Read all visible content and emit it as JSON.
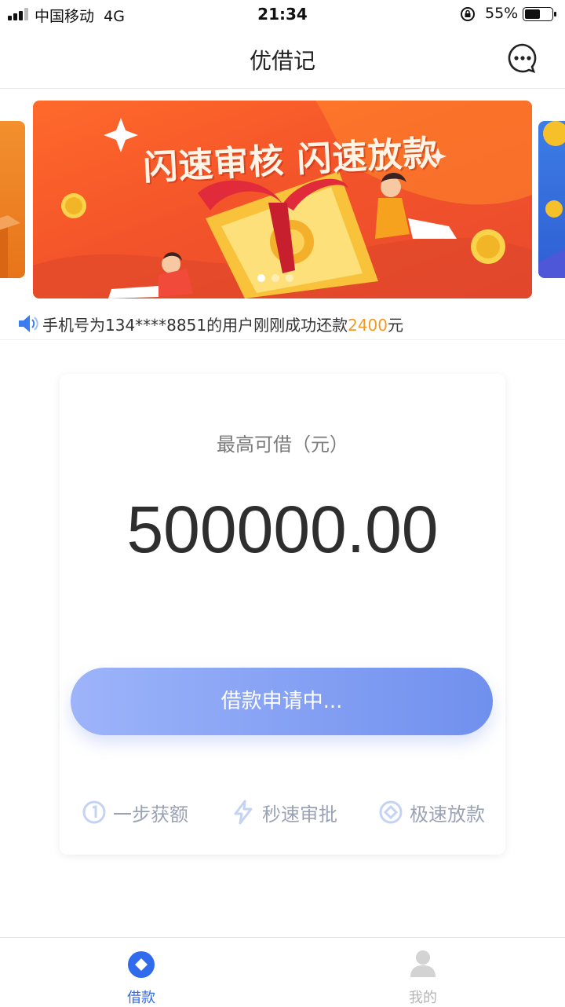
{
  "status_bar": {
    "carrier": "中国移动",
    "network": "4G",
    "time": "21:34",
    "battery": "55%"
  },
  "nav": {
    "title": "优借记",
    "more_icon": "chat-bubble-dots-icon"
  },
  "banner": {
    "headline": "闪速审核 闪速放款",
    "active_index": 0,
    "slide_count": 3
  },
  "notice": {
    "prefix": "手机号为134****8851的用户刚刚成功还款",
    "amount": "2400",
    "suffix": "元"
  },
  "loan_card": {
    "label": "最高可借（元）",
    "amount": "500000.00",
    "button": "借款申请中...",
    "features": [
      "一步获额",
      "秒速审批",
      "极速放款"
    ]
  },
  "tabs": [
    {
      "label": "借款",
      "active": true,
      "icon": "loan-diamond-icon"
    },
    {
      "label": "我的",
      "active": false,
      "icon": "user-icon"
    }
  ],
  "colors": {
    "accent": "#2f6bec",
    "highlight": "#f39b21",
    "button_start": "#9db4fa",
    "button_end": "#7090ee"
  }
}
